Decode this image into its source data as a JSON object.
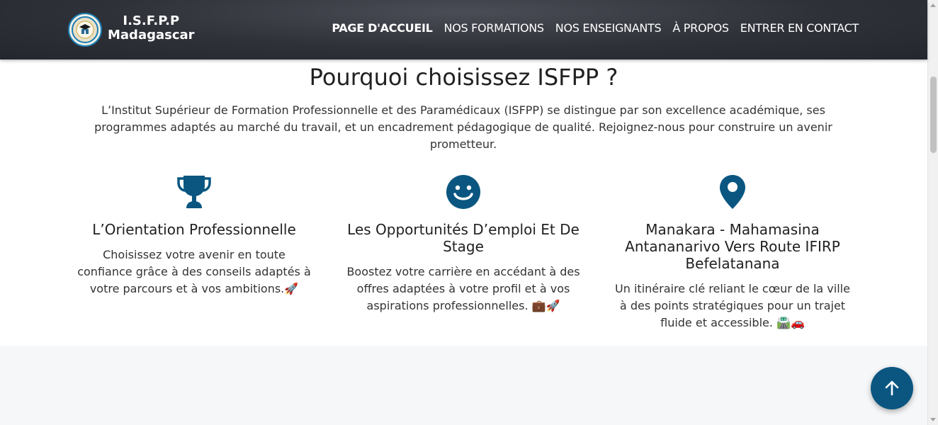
{
  "header": {
    "brand_line1": "I.S.F.P.P",
    "brand_line2": "Madagascar",
    "nav": [
      {
        "label": "PAGE D'ACCUEIL",
        "active": true
      },
      {
        "label": "NOS FORMATIONS"
      },
      {
        "label": "NOS ENSEIGNANTS"
      },
      {
        "label": "À PROPOS"
      },
      {
        "label": "ENTRER EN CONTACT"
      }
    ]
  },
  "section": {
    "title": "Pourquoi choisissez ISFPP ?",
    "intro": "L’Institut Supérieur de Formation Professionnelle et des Paramédicaux (ISFPP) se distingue par son excellence académique, ses programmes adaptés au marché du travail, et un encadrement pédagogique de qualité. Rejoignez-nous pour construire un avenir prometteur.",
    "features": [
      {
        "icon": "trophy-icon",
        "title": "L’Orientation Professionnelle",
        "text": "Choisissez votre avenir en toute confiance grâce à des conseils adaptés à votre parcours et à vos ambitions.🚀"
      },
      {
        "icon": "smiley-icon",
        "title": "Les Opportunités D’emploi Et De Stage",
        "text": "Boostez votre carrière en accédant à des offres adaptées à votre profil et à vos aspirations professionnelles. 💼🚀"
      },
      {
        "icon": "map-pin-icon",
        "title": "Manakara - Mahamasina Antananarivo Vers Route IFIRP Befelatanana",
        "text": "Un itinéraire clé reliant le cœur de la ville à des points stratégiques pour un trajet fluide et accessible. 🛣️🚗"
      }
    ]
  },
  "colors": {
    "header_bg": "#2e3138",
    "accent": "#0a5681",
    "icon": "#0a5681",
    "band_bg": "#f6f7f9"
  }
}
